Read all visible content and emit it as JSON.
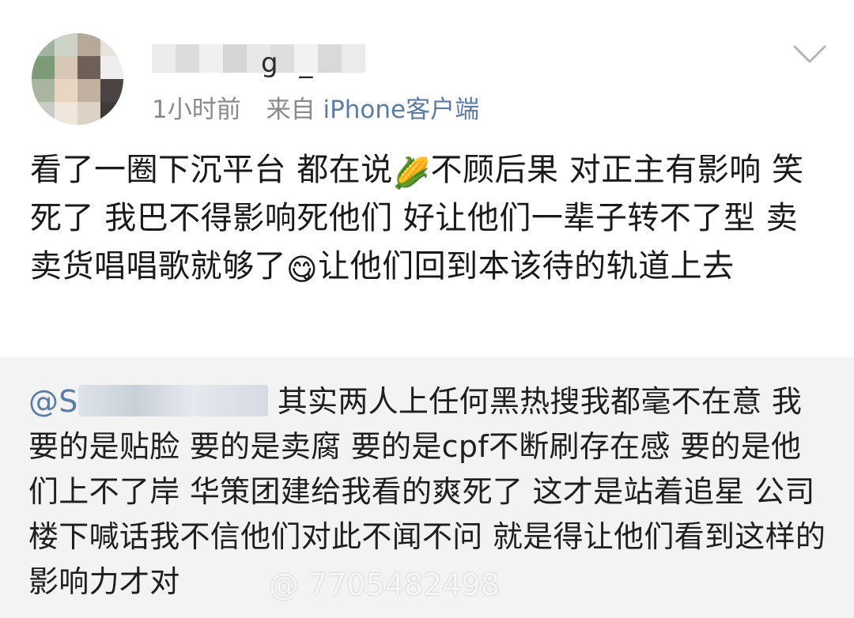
{
  "post": {
    "username_suffix": "g _",
    "time": "1小时前",
    "source_prefix": "来自",
    "source": "iPhone客户端",
    "icons": {
      "expand": "chevron-down-icon",
      "emoji_corn": "🌽",
      "emoji_face": "😋"
    },
    "text_part1": "看了一圈下沉平台 都在说",
    "text_part2": "不顾后果 对正主有影响 笑死了 我巴不得影响死他们 好让他们一辈子转不了型 卖卖货唱唱歌就够了",
    "text_part3": "让他们回到本该待的轨道上去"
  },
  "repost": {
    "mention": "@S",
    "text": "其实两人上任何黑热搜我都毫不在意 我要的是贴脸 要的是卖腐 要的是cpf不断刷存在感 要的是他们上不了岸 华策团建给我看的爽死了 这才是站着追星 公司楼下喊话我不信他们对此不闻不问 就是得让他们看到这样的影响力才对"
  },
  "watermark": {
    "text": "@ 7705482498"
  },
  "colors": {
    "link": "#5b7ca6",
    "meta_gray": "#8a8a8a",
    "repost_bg": "#f3f3f3"
  }
}
